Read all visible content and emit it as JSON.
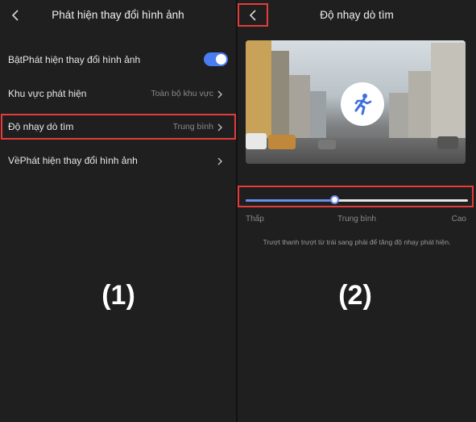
{
  "left_screen": {
    "title": "Phát hiện thay đổi hình ảnh",
    "rows": [
      {
        "label": "BậtPhát hiện thay đổi hình ảnh",
        "toggle_on": true
      },
      {
        "label": "Khu vực phát hiện",
        "value": "Toàn bộ khu vực"
      },
      {
        "label": "Độ nhạy dò tìm",
        "value": "Trung bình"
      },
      {
        "label": "VềPhát hiện thay đổi hình ảnh"
      }
    ],
    "step_label": "(1)"
  },
  "right_screen": {
    "title": "Độ nhạy dò tìm",
    "slider": {
      "min_label": "Thấp",
      "mid_label": "Trung bình",
      "max_label": "Cao",
      "level": 0.4
    },
    "hint": "Trượt thanh trượt từ trái sang phải để tăng độ nhạy phát hiện.",
    "step_label": "(2)"
  },
  "icons": {
    "back": "chevron-left-icon",
    "chevron": "chevron-right-icon",
    "motion": "running-person-icon"
  },
  "colors": {
    "background": "#1f1f1f",
    "accent": "#4a7cf3",
    "highlight": "#e53b3b"
  }
}
